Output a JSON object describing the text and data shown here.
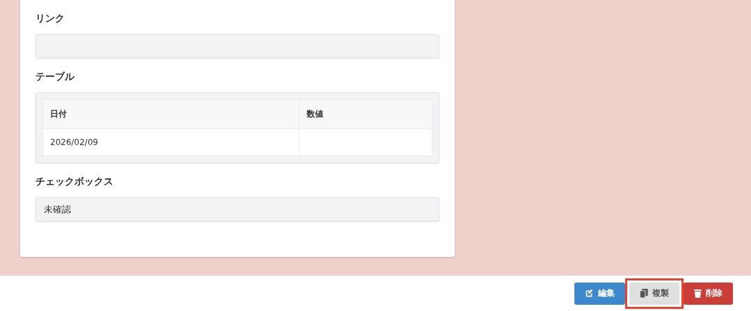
{
  "sections": [
    {
      "kind": "field",
      "label": "リンク"
    },
    {
      "kind": "table",
      "label": "テーブル",
      "columns": [
        "日付",
        "数値"
      ],
      "rows": [
        [
          "2026/02/09",
          ""
        ]
      ]
    },
    {
      "kind": "field",
      "label": "チェックボックス",
      "value": "未確認"
    }
  ],
  "actions": [
    {
      "kind": "edit",
      "label": "編集",
      "highlighted": false
    },
    {
      "kind": "copy",
      "label": "複製",
      "highlighted": true
    },
    {
      "kind": "delete",
      "label": "削除",
      "highlighted": false
    }
  ]
}
